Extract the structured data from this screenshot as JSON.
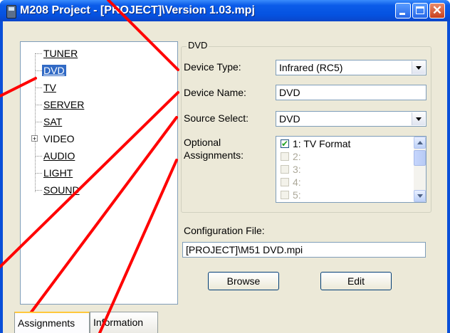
{
  "window": {
    "title": "M208 Project - [PROJECT]\\Version 1.03.mpj"
  },
  "tree": {
    "items": [
      {
        "label": "TUNER",
        "selected": false
      },
      {
        "label": "DVD",
        "selected": true
      },
      {
        "label": "TV",
        "selected": false
      },
      {
        "label": "SERVER",
        "selected": false
      },
      {
        "label": "SAT",
        "selected": false
      },
      {
        "label": "VIDEO",
        "selected": false,
        "expandable": true,
        "expander": "+"
      },
      {
        "label": "AUDIO",
        "selected": false
      },
      {
        "label": "LIGHT",
        "selected": false
      },
      {
        "label": "SOUND",
        "selected": false
      }
    ]
  },
  "group": {
    "legend": "DVD",
    "device_type_label": "Device Type:",
    "device_type_value": "Infrared (RC5)",
    "device_name_label": "Device Name:",
    "device_name_value": "DVD",
    "source_select_label": "Source Select:",
    "source_select_value": "DVD",
    "optional_label_line1": "Optional",
    "optional_label_line2": "Assignments:",
    "assignments": [
      {
        "label": "1: TV Format",
        "checked": true,
        "enabled": true
      },
      {
        "label": "2:",
        "checked": false,
        "enabled": false
      },
      {
        "label": "3:",
        "checked": false,
        "enabled": false
      },
      {
        "label": "4:",
        "checked": false,
        "enabled": false
      },
      {
        "label": "5:",
        "checked": false,
        "enabled": false
      }
    ]
  },
  "config": {
    "label": "Configuration File:",
    "value": "[PROJECT]\\M51 DVD.mpi",
    "browse_label": "Browse",
    "edit_label": "Edit"
  },
  "tabs": [
    {
      "label": "Assignments",
      "active": true
    },
    {
      "label": "Information",
      "active": false
    }
  ],
  "colors": {
    "annotation": "#ff0000",
    "selection": "#316ac5",
    "titlebar": "#0552e0"
  }
}
